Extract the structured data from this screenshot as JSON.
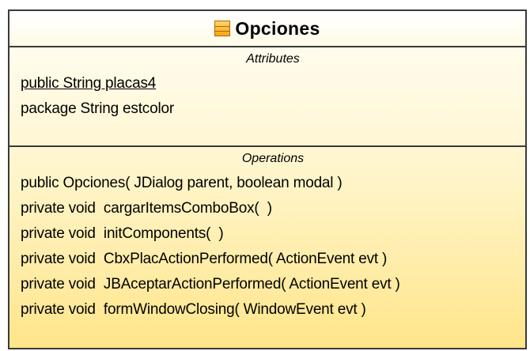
{
  "class": {
    "name": "Opciones",
    "icon": "class-icon",
    "attributes_label": "Attributes",
    "attributes": [
      {
        "text": "public String placas4",
        "static": true
      },
      {
        "text": "package String estcolor",
        "static": false
      }
    ],
    "operations_label": "Operations",
    "operations": [
      {
        "text": "public Opciones( JDialog parent, boolean modal )"
      },
      {
        "text": "private void  cargarItemsComboBox(  )"
      },
      {
        "text": "private void  initComponents(  )"
      },
      {
        "text": "private void  CbxPlacActionPerformed( ActionEvent evt )"
      },
      {
        "text": "private void  JBAceptarActionPerformed( ActionEvent evt )"
      },
      {
        "text": "private void  formWindowClosing( WindowEvent evt )"
      }
    ]
  }
}
